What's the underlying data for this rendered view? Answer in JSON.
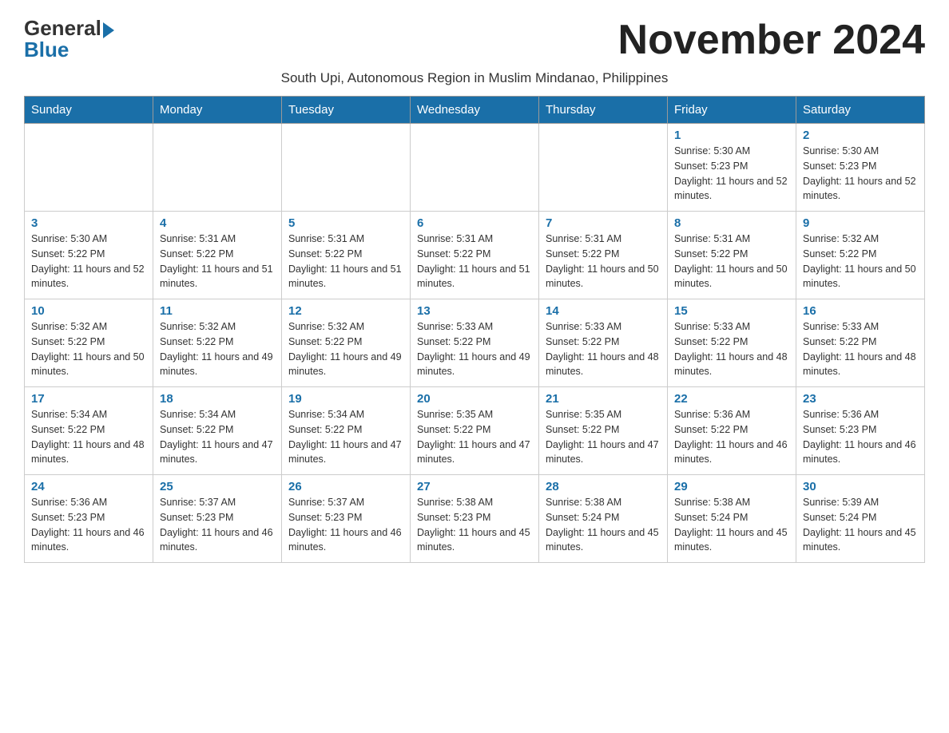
{
  "logo": {
    "general": "General",
    "blue": "Blue"
  },
  "title": "November 2024",
  "subtitle": "South Upi, Autonomous Region in Muslim Mindanao, Philippines",
  "weekdays": [
    "Sunday",
    "Monday",
    "Tuesday",
    "Wednesday",
    "Thursday",
    "Friday",
    "Saturday"
  ],
  "weeks": [
    [
      {
        "day": "",
        "info": ""
      },
      {
        "day": "",
        "info": ""
      },
      {
        "day": "",
        "info": ""
      },
      {
        "day": "",
        "info": ""
      },
      {
        "day": "",
        "info": ""
      },
      {
        "day": "1",
        "info": "Sunrise: 5:30 AM\nSunset: 5:23 PM\nDaylight: 11 hours and 52 minutes."
      },
      {
        "day": "2",
        "info": "Sunrise: 5:30 AM\nSunset: 5:23 PM\nDaylight: 11 hours and 52 minutes."
      }
    ],
    [
      {
        "day": "3",
        "info": "Sunrise: 5:30 AM\nSunset: 5:22 PM\nDaylight: 11 hours and 52 minutes."
      },
      {
        "day": "4",
        "info": "Sunrise: 5:31 AM\nSunset: 5:22 PM\nDaylight: 11 hours and 51 minutes."
      },
      {
        "day": "5",
        "info": "Sunrise: 5:31 AM\nSunset: 5:22 PM\nDaylight: 11 hours and 51 minutes."
      },
      {
        "day": "6",
        "info": "Sunrise: 5:31 AM\nSunset: 5:22 PM\nDaylight: 11 hours and 51 minutes."
      },
      {
        "day": "7",
        "info": "Sunrise: 5:31 AM\nSunset: 5:22 PM\nDaylight: 11 hours and 50 minutes."
      },
      {
        "day": "8",
        "info": "Sunrise: 5:31 AM\nSunset: 5:22 PM\nDaylight: 11 hours and 50 minutes."
      },
      {
        "day": "9",
        "info": "Sunrise: 5:32 AM\nSunset: 5:22 PM\nDaylight: 11 hours and 50 minutes."
      }
    ],
    [
      {
        "day": "10",
        "info": "Sunrise: 5:32 AM\nSunset: 5:22 PM\nDaylight: 11 hours and 50 minutes."
      },
      {
        "day": "11",
        "info": "Sunrise: 5:32 AM\nSunset: 5:22 PM\nDaylight: 11 hours and 49 minutes."
      },
      {
        "day": "12",
        "info": "Sunrise: 5:32 AM\nSunset: 5:22 PM\nDaylight: 11 hours and 49 minutes."
      },
      {
        "day": "13",
        "info": "Sunrise: 5:33 AM\nSunset: 5:22 PM\nDaylight: 11 hours and 49 minutes."
      },
      {
        "day": "14",
        "info": "Sunrise: 5:33 AM\nSunset: 5:22 PM\nDaylight: 11 hours and 48 minutes."
      },
      {
        "day": "15",
        "info": "Sunrise: 5:33 AM\nSunset: 5:22 PM\nDaylight: 11 hours and 48 minutes."
      },
      {
        "day": "16",
        "info": "Sunrise: 5:33 AM\nSunset: 5:22 PM\nDaylight: 11 hours and 48 minutes."
      }
    ],
    [
      {
        "day": "17",
        "info": "Sunrise: 5:34 AM\nSunset: 5:22 PM\nDaylight: 11 hours and 48 minutes."
      },
      {
        "day": "18",
        "info": "Sunrise: 5:34 AM\nSunset: 5:22 PM\nDaylight: 11 hours and 47 minutes."
      },
      {
        "day": "19",
        "info": "Sunrise: 5:34 AM\nSunset: 5:22 PM\nDaylight: 11 hours and 47 minutes."
      },
      {
        "day": "20",
        "info": "Sunrise: 5:35 AM\nSunset: 5:22 PM\nDaylight: 11 hours and 47 minutes."
      },
      {
        "day": "21",
        "info": "Sunrise: 5:35 AM\nSunset: 5:22 PM\nDaylight: 11 hours and 47 minutes."
      },
      {
        "day": "22",
        "info": "Sunrise: 5:36 AM\nSunset: 5:22 PM\nDaylight: 11 hours and 46 minutes."
      },
      {
        "day": "23",
        "info": "Sunrise: 5:36 AM\nSunset: 5:23 PM\nDaylight: 11 hours and 46 minutes."
      }
    ],
    [
      {
        "day": "24",
        "info": "Sunrise: 5:36 AM\nSunset: 5:23 PM\nDaylight: 11 hours and 46 minutes."
      },
      {
        "day": "25",
        "info": "Sunrise: 5:37 AM\nSunset: 5:23 PM\nDaylight: 11 hours and 46 minutes."
      },
      {
        "day": "26",
        "info": "Sunrise: 5:37 AM\nSunset: 5:23 PM\nDaylight: 11 hours and 46 minutes."
      },
      {
        "day": "27",
        "info": "Sunrise: 5:38 AM\nSunset: 5:23 PM\nDaylight: 11 hours and 45 minutes."
      },
      {
        "day": "28",
        "info": "Sunrise: 5:38 AM\nSunset: 5:24 PM\nDaylight: 11 hours and 45 minutes."
      },
      {
        "day": "29",
        "info": "Sunrise: 5:38 AM\nSunset: 5:24 PM\nDaylight: 11 hours and 45 minutes."
      },
      {
        "day": "30",
        "info": "Sunrise: 5:39 AM\nSunset: 5:24 PM\nDaylight: 11 hours and 45 minutes."
      }
    ]
  ]
}
